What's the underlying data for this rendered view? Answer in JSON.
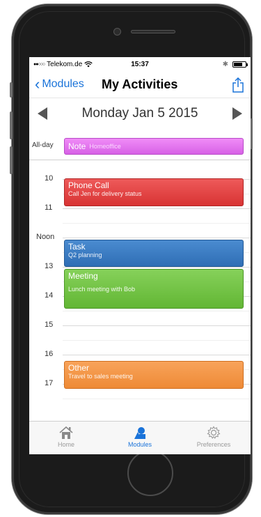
{
  "status_bar": {
    "carrier": "Telekom.de",
    "time": "15:37"
  },
  "nav": {
    "back_label": "Modules",
    "title": "My Activities"
  },
  "date_bar": {
    "date": "Monday Jan 5 2015"
  },
  "all_day": {
    "label": "All-day",
    "event": {
      "title": "Note",
      "subtitle": "Homeoffice"
    }
  },
  "timeline": {
    "hours": [
      "10",
      "11",
      "Noon",
      "13",
      "14",
      "15",
      "16",
      "17"
    ],
    "events": [
      {
        "title": "Phone Call",
        "subtitle": "Call Jen for delivery status"
      },
      {
        "title": "Task",
        "subtitle": "Q2 planning"
      },
      {
        "title": "Meeting",
        "subtitle": "Lunch meeting with Bob"
      },
      {
        "title": "Other",
        "subtitle": "Travel to sales meeting"
      }
    ]
  },
  "tab_bar": {
    "tabs": [
      {
        "label": "Home",
        "icon": "home-icon"
      },
      {
        "label": "Modules",
        "icon": "modules-icon"
      },
      {
        "label": "Preferences",
        "icon": "gear-icon"
      }
    ],
    "active": "Modules"
  },
  "colors": {
    "accent": "#1a73d9",
    "note": "#e277ef",
    "phone_call": "#e04646",
    "task": "#3a7cc4",
    "meeting": "#72c443",
    "other": "#f29745"
  }
}
